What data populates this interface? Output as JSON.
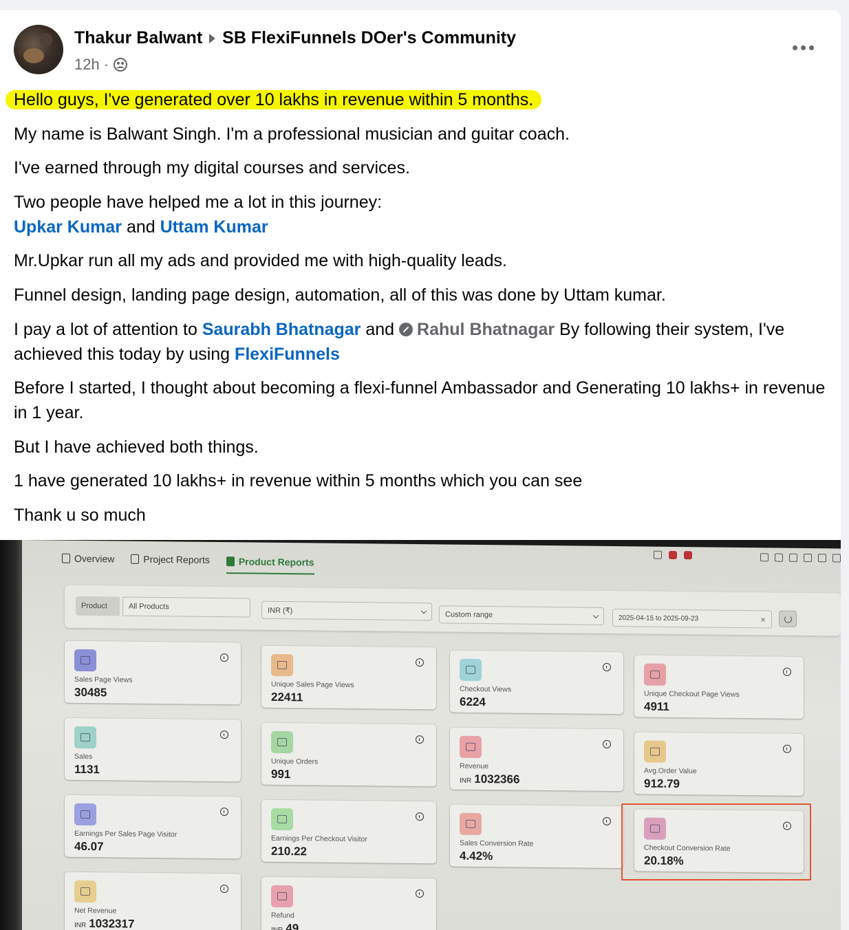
{
  "post": {
    "author": "Thakur Balwant",
    "group": "SB FlexiFunnels DOer's Community",
    "time": "12h",
    "separator": "·",
    "headline": "Hello guys, I've generated over 10 lakhs in revenue within 5 months.",
    "p1": "My name is Balwant Singh. I'm a professional musician and guitar coach.",
    "p2": "I've earned through my digital courses and services.",
    "p3": "Two people have helped me a lot in this journey:",
    "mention1": "Upkar Kumar",
    "and": "and",
    "mention2": "Uttam Kumar",
    "p4": "Mr.Upkar run all my ads and provided me with high-quality leads.",
    "p5": "Funnel design, landing page design, automation, all of this was done by Uttam kumar.",
    "p6_a": "I pay a lot of attention to",
    "mention3": "Saurabh Bhatnagar",
    "mention4": "Rahul Bhatnagar",
    "p6_b": "By following their system, I've achieved this today by using",
    "mention5": "FlexiFunnels",
    "p7": "Before I started, I thought about becoming a flexi-funnel Ambassador and Generating 10 lakhs+ in revenue in 1 year.",
    "p8": "But I have achieved both things.",
    "p9": "1 have generated 10 lakhs+ in revenue within 5 months which you can see",
    "p10": "Thank u so much"
  },
  "dashboard": {
    "tabs": [
      "Overview",
      "Project Reports",
      "Product Reports"
    ],
    "filters": {
      "product_label": "Product",
      "product_value": "All Products",
      "currency": "INR (₹)",
      "range": "Custom range",
      "date_range": "2025-04-15  to  2025-09-23"
    },
    "metrics": [
      {
        "label": "Sales Page Views",
        "value": "30485",
        "currency": "",
        "icon": "bar-chart-icon",
        "color": "#8a8fd6"
      },
      {
        "label": "Unique Sales Page Views",
        "value": "22411",
        "currency": "",
        "icon": "user-icon",
        "color": "#e8b98a"
      },
      {
        "label": "Checkout Views",
        "value": "6224",
        "currency": "",
        "icon": "basket-icon",
        "color": "#9fd3d8"
      },
      {
        "label": "Unique Checkout Page Views",
        "value": "4911",
        "currency": "",
        "icon": "chart-icon",
        "color": "#e6a1a8"
      },
      {
        "label": "Sales",
        "value": "1131",
        "currency": "",
        "icon": "money-icon",
        "color": "#9ed2c6"
      },
      {
        "label": "Unique Orders",
        "value": "991",
        "currency": "",
        "icon": "receipt-icon",
        "color": "#a6d6a2"
      },
      {
        "label": "Revenue",
        "value": "1032366",
        "currency": "INR",
        "icon": "wallet-icon",
        "color": "#e8a2a6"
      },
      {
        "label": "Avg.Order Value",
        "value": "912.79",
        "currency": "",
        "icon": "bag-icon",
        "color": "#e6c98a"
      },
      {
        "label": "Earnings Per Sales Page Visitor",
        "value": "46.07",
        "currency": "",
        "icon": "dollar-icon",
        "color": "#9aa0e0"
      },
      {
        "label": "Earnings Per Checkout Visitor",
        "value": "210.22",
        "currency": "",
        "icon": "people-icon",
        "color": "#a8dca4"
      },
      {
        "label": "Sales Conversion Rate",
        "value": "4.42%",
        "currency": "",
        "icon": "sales-icon",
        "color": "#e8a8a2"
      },
      {
        "label": "Checkout Conversion Rate",
        "value": "20.18%",
        "currency": "",
        "icon": "trend-icon",
        "color": "#d9a0bc"
      },
      {
        "label": "Net Revenue",
        "value": "1032317",
        "currency": "INR",
        "icon": "line-chart-icon",
        "color": "#e6cf8e"
      },
      {
        "label": "Refund",
        "value": "49",
        "currency": "INR",
        "icon": "refund-icon",
        "color": "#e6a0ae"
      }
    ]
  }
}
